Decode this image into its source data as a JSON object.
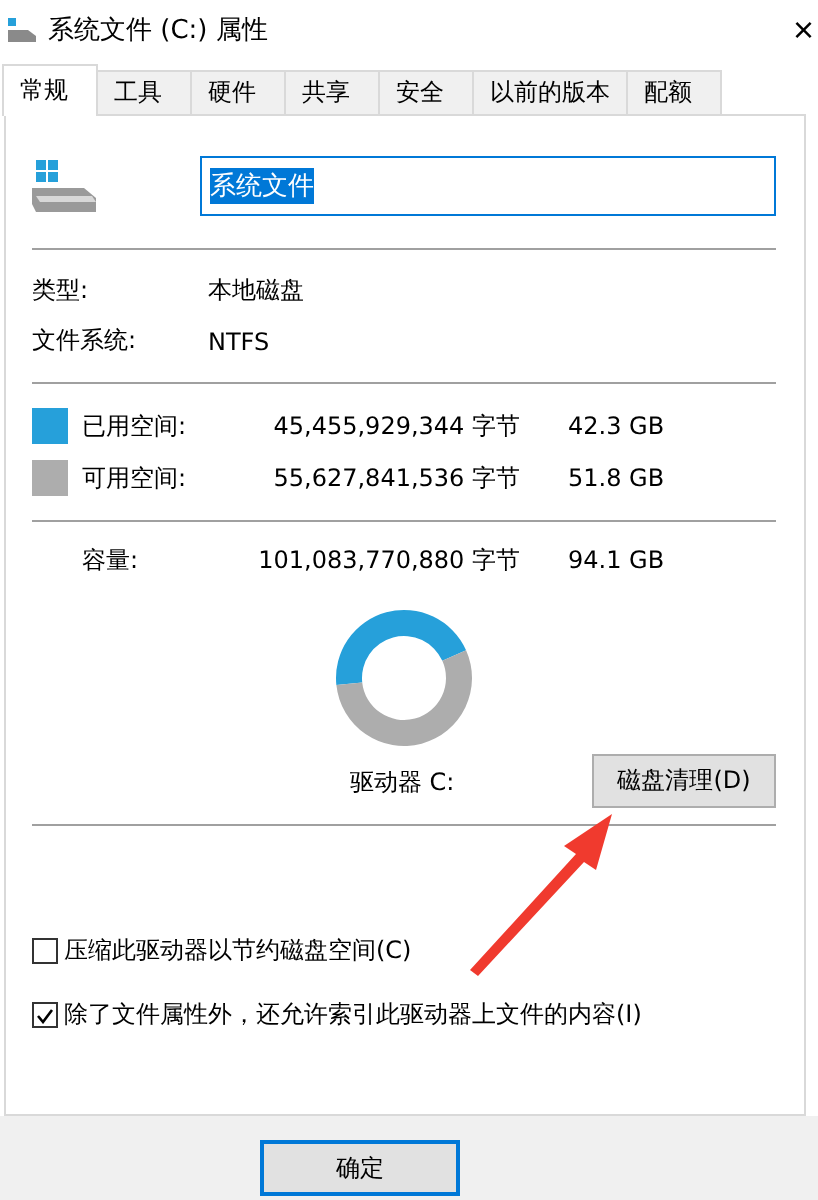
{
  "window": {
    "title": "系统文件 (C:) 属性",
    "close": "×"
  },
  "tabs": [
    {
      "label": "常规",
      "selected": true
    },
    {
      "label": "工具",
      "selected": false
    },
    {
      "label": "硬件",
      "selected": false
    },
    {
      "label": "共享",
      "selected": false
    },
    {
      "label": "安全",
      "selected": false
    },
    {
      "label": "以前的版本",
      "selected": false
    },
    {
      "label": "配额",
      "selected": false
    }
  ],
  "drive": {
    "name": "系统文件",
    "name_selected": true
  },
  "info": [
    {
      "label": "类型:",
      "value": "本地磁盘"
    },
    {
      "label": "文件系统:",
      "value": "NTFS"
    }
  ],
  "space": [
    {
      "label": "已用空间:",
      "bytes": "45,455,929,344 字节",
      "size": "42.3 GB",
      "color": "#26a0da"
    },
    {
      "label": "可用空间:",
      "bytes": "55,627,841,536 字节",
      "size": "51.8 GB",
      "color": "#adadad"
    }
  ],
  "capacity": {
    "label": "容量:",
    "bytes": "101,083,770,880 字节",
    "size": "94.1 GB"
  },
  "chart_data": {
    "type": "donut",
    "values": [
      44.97,
      55.03
    ]
  },
  "drive_label": "驱动器 C:",
  "cleanup_button": "磁盘清理(D)",
  "options": [
    {
      "label": "压缩此驱动器以节约磁盘空间(C)",
      "checked": false
    },
    {
      "label": "除了文件属性外，还允许索引此驱动器上文件的内容(I)",
      "checked": true
    }
  ],
  "buttons": [
    "确定"
  ]
}
